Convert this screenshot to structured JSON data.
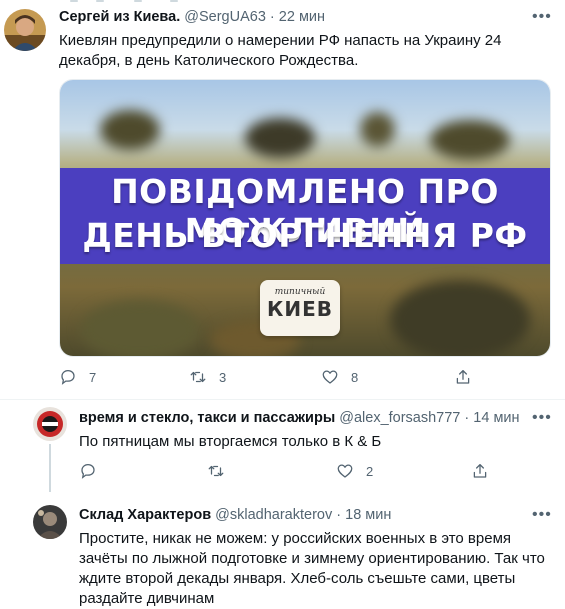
{
  "tweets": [
    {
      "name": "Сергей из Киева.",
      "handle": "@SergUA63",
      "dot": "·",
      "time": "22 мин",
      "text": "Киевлян предупредили о намерении РФ напасть на Украину 24 декабря, в день Католического Рождества.",
      "media": {
        "banner_line1": "ПОВІДОМЛЕНО ПРО МОЖЛИВИЙ",
        "banner_line2": "ДЕНЬ ВТОРГНЕННЯ РФ",
        "logo_small": "типичный",
        "logo_big": "КИЕВ"
      },
      "counts": {
        "reply": "7",
        "retweet": "3",
        "like": "8"
      }
    },
    {
      "name": "время и стекло, такси и пассажиры",
      "handle": "@alex_forsash777",
      "dot": "·",
      "time": "14 мин",
      "text": "По пятницам мы вторгаемся только в К & Б",
      "counts": {
        "reply": "",
        "retweet": "",
        "like": "2"
      }
    },
    {
      "name": "Склад Характеров",
      "handle": "@skladharakterov",
      "dot": "·",
      "time": "18 мин",
      "text": "Простите, никак не можем: у российских военных в это время зачёты по лыжной подготовке и зимнему ориентированию. Так что ждите второй декады января. Хлеб-соль съешьте сами, цветы раздайте дивчинам"
    }
  ],
  "icons": {
    "more": "more-icon",
    "reply": "reply-icon",
    "retweet": "retweet-icon",
    "like": "heart-icon",
    "share": "share-icon"
  },
  "colors": {
    "text": "#0f1419",
    "secondary": "#536471",
    "divider": "#eff3f4",
    "banner": "#4b3fbf"
  }
}
